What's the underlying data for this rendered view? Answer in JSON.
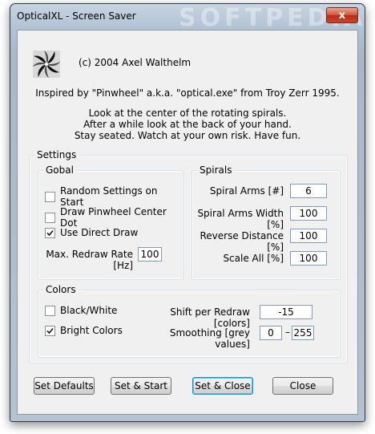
{
  "window": {
    "title": "OpticalXL - Screen Saver",
    "close_glyph": "x",
    "watermark": "SOFTPEDIA"
  },
  "header": {
    "copyright": "(c) 2004 Axel Walthelm",
    "inspired": "Inspired by \"Pinwheel\" a.k.a. \"optical.exe\" from Troy Zerr 1995.",
    "instructions": [
      "Look at the center of the rotating spirals.",
      "After a while look at the back of your hand.",
      "Stay seated. Watch at your own risk. Have fun."
    ]
  },
  "settings": {
    "label": "Settings",
    "global": {
      "label": "Gobal",
      "random_settings": {
        "label": "Random Settings on Start",
        "checked": false
      },
      "draw_center_dot": {
        "label": "Draw Pinwheel Center Dot",
        "checked": false
      },
      "direct_draw": {
        "label": "Use Direct Draw",
        "checked": true
      },
      "max_redraw": {
        "label": "Max. Redraw Rate [Hz]",
        "value": "100"
      }
    },
    "spirals": {
      "label": "Spirals",
      "arms": {
        "label": "Spiral Arms [#]",
        "value": "6"
      },
      "arms_width": {
        "label": "Spiral Arms Width [%]",
        "value": "100"
      },
      "reverse_distance": {
        "label": "Reverse Distance [%]",
        "value": "100"
      },
      "scale_all": {
        "label": "Scale All [%]",
        "value": "100"
      }
    },
    "colors": {
      "label": "Colors",
      "black_white": {
        "label": "Black/White",
        "checked": false
      },
      "bright_colors": {
        "label": "Bright Colors",
        "checked": true
      },
      "shift": {
        "label": "Shift per Redraw [colors]",
        "value": "-15"
      },
      "smoothing": {
        "label": "Smoothing [grey values]",
        "min": "0",
        "dash": "–",
        "max": "255"
      }
    }
  },
  "buttons": {
    "set_defaults": "Set Defaults",
    "set_start": "Set & Start",
    "set_close": "Set & Close",
    "close": "Close"
  }
}
